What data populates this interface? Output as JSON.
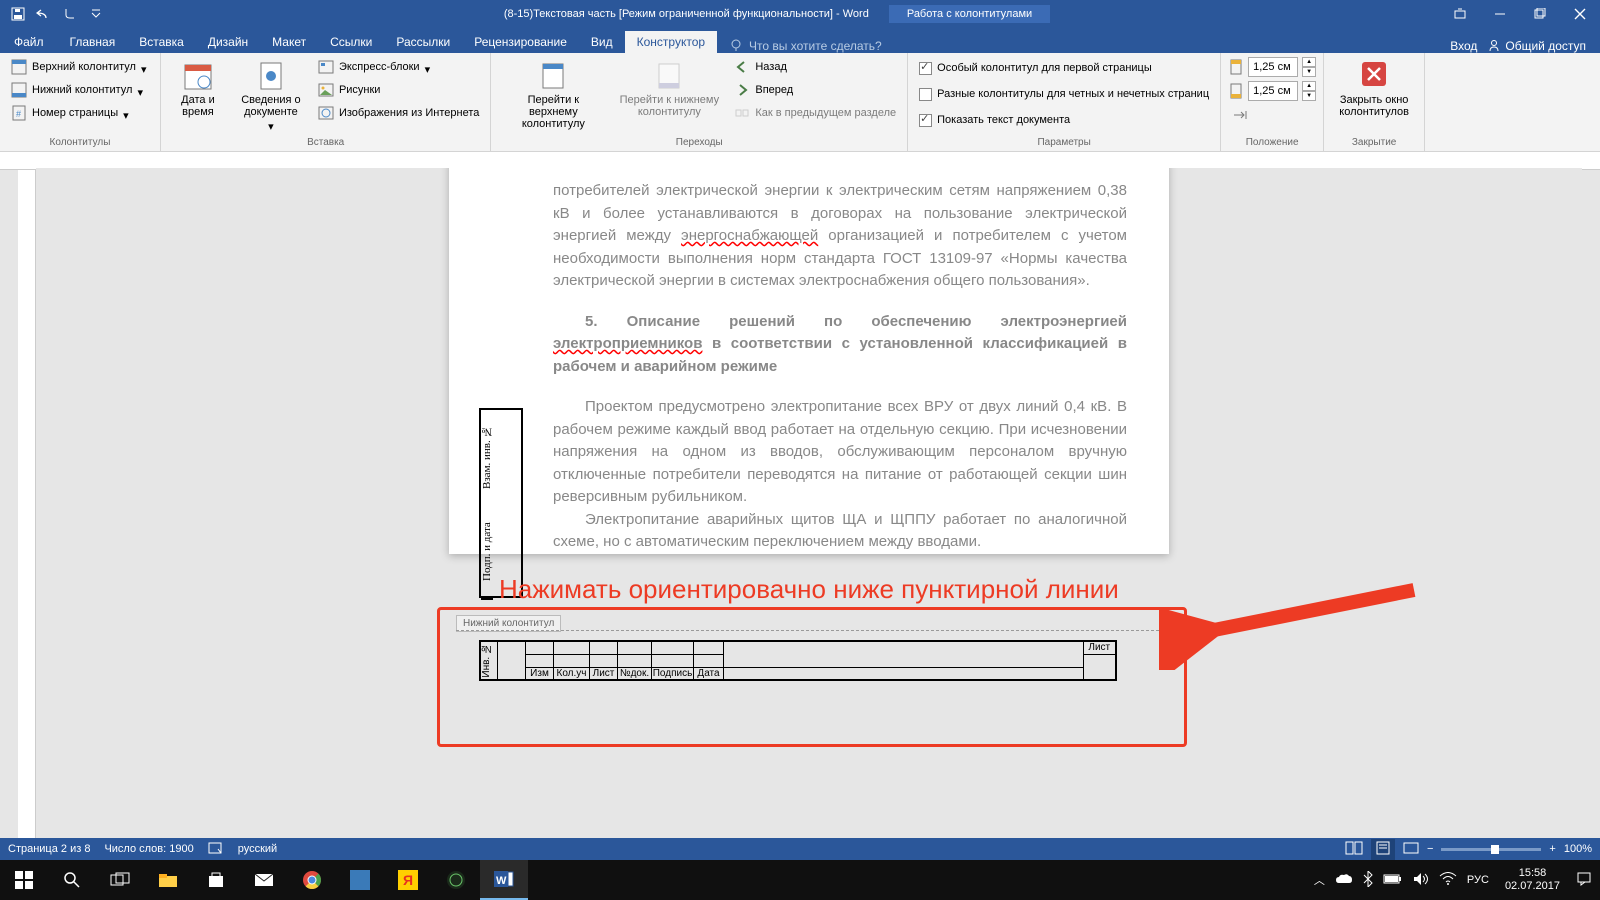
{
  "title": "(8-15)Текстовая часть [Режим ограниченной функциональности] - Word",
  "context_tab": "Работа с колонтитулами",
  "tabs": {
    "file": "Файл",
    "home": "Главная",
    "insert": "Вставка",
    "design": "Дизайн",
    "layout": "Макет",
    "links": "Ссылки",
    "mailings": "Рассылки",
    "review": "Рецензирование",
    "view": "Вид",
    "designer": "Конструктор"
  },
  "tell_me": "Что вы хотите сделать?",
  "right_commands": {
    "signin": "Вход",
    "share": "Общий доступ"
  },
  "ribbon": {
    "g1": {
      "label": "Колонтитулы",
      "header": "Верхний колонтитул",
      "footer": "Нижний колонтитул",
      "pagenum": "Номер страницы"
    },
    "g2": {
      "label": "Вставка",
      "date": "Дата и время",
      "docinfo": "Сведения о документе",
      "quick": "Экспресс-блоки",
      "pics": "Рисунки",
      "online": "Изображения из Интернета"
    },
    "g3": {
      "label": "Переходы",
      "gotoheader": "Перейти к верхнему колонтитулу",
      "gotofooter": "Перейти к нижнему колонтитулу",
      "back": "Назад",
      "forward": "Вперед",
      "prev": "Как в предыдущем разделе"
    },
    "g4": {
      "label": "Параметры",
      "first": "Особый колонтитул для первой страницы",
      "oddeven": "Разные колонтитулы для четных и нечетных страниц",
      "showdoc": "Показать текст документа"
    },
    "g5": {
      "label": "Положение",
      "top": "1,25 см",
      "bottom": "1,25 см"
    },
    "g6": {
      "label": "Закрытие",
      "close": "Закрыть окно колонтитулов"
    }
  },
  "doc": {
    "p1a": "потребителей электрической энергии к электрическим сетям напряжением 0,38 кВ и более устанавливаются в договорах на пользование электрической энергией между ",
    "p1u": "энергоснабжающей",
    "p1b": " организацией и потребителем с учетом необходимости выполнения норм стандарта ГОСТ 13109-97 «Нормы качества электрической энергии в системах электроснабжения общего пользования».",
    "h5": "5. Описание решений по обеспечению электроэнергией ",
    "h5u": "электроприемников",
    "h5b": " в соответствии с установленной классификацией в рабочем и аварийном режиме",
    "p2": "Проектом предусмотрено электропитание всех ВРУ от двух линий 0,4 кВ. В рабочем режиме каждый ввод работает на отдельную секцию. При исчезновении напряжения на одном из вводов, обслуживающим персоналом вручную отключенные потребители переводятся на питание от работающей секции шин реверсивным рубильником.",
    "p3": "Электропитание аварийных щитов ЩА и ЩППУ работает по аналогичной схеме, но с автоматическим переключением между вводами.",
    "side1": "Взам. инв. №",
    "side2": "Подп. и дата",
    "inv": "Инв. №",
    "footer_label": "Нижний колонтитул",
    "th": [
      "Изм",
      "Кол.уч",
      "Лист",
      "№док.",
      "Подпись",
      "Дата"
    ],
    "sheet": "Лист"
  },
  "annotation": "Нажимать ориентировачно ниже пунктирной линии",
  "status": {
    "page": "Страница 2 из 8",
    "words": "Число слов: 1900",
    "lang": "русский",
    "zoom": "100%"
  },
  "tray": {
    "lang": "РУС",
    "time": "15:58",
    "date": "02.07.2017"
  }
}
